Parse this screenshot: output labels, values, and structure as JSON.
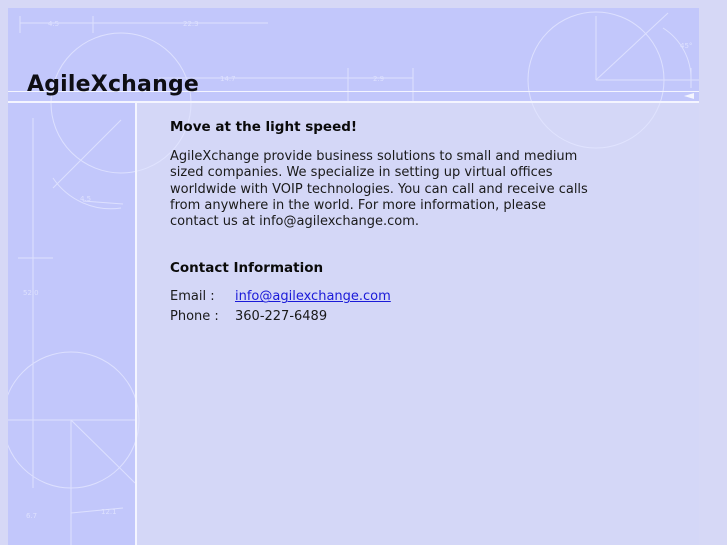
{
  "site": {
    "logo": "AgileXchange"
  },
  "main": {
    "heading": "Move at the light speed!",
    "intro": "AgileXchange provide business solutions to small and medium sized companies.  We specialize in setting up virtual offices worldwide with VOIP technologies.  You can call and receive calls from anywhere in the world.  For more information, please contact us at info@agilexchange.com."
  },
  "contact": {
    "title": "Contact Information",
    "email_label": "Email :",
    "email_value": "info@agilexchange.com",
    "phone_label": "Phone :",
    "phone_value": "360-227-6489"
  },
  "deco": {
    "dim_labels": [
      "4.5",
      "22.3",
      "14.7",
      "2.9",
      "4.5",
      "52.0",
      "6.7",
      "12.1",
      "45°"
    ]
  },
  "colors": {
    "page_bg": "#d6d8f6",
    "panel_bg": "#c2c7fb",
    "content_bg": "#d4d7f7",
    "link": "#1a1ad8"
  }
}
